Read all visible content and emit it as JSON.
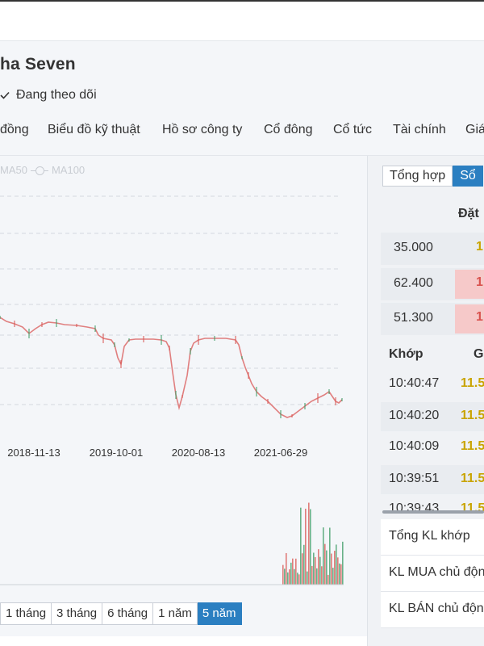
{
  "company_name": "ha Seven",
  "follow_status": "Đang theo dõi",
  "tabs": [
    "đồng",
    "Biểu đồ kỹ thuật",
    "Hồ sơ công ty",
    "Cổ đông",
    "Cổ tức",
    "Tài chính",
    "Giá"
  ],
  "chart": {
    "legend": [
      "MA50",
      "MA100"
    ],
    "dates": [
      "2018-11-13",
      "2019-10-01",
      "2020-08-13",
      "2021-06-29"
    ],
    "ranges": [
      "1 tháng",
      "3 tháng",
      "6 tháng",
      "1 năm",
      "5 năm"
    ],
    "active_range": "5 năm",
    "colors": {
      "price_line": "#e07f7f",
      "candle_up": "#3a9a62",
      "candle_down": "#d9534f",
      "grid": "#d3d8de"
    }
  },
  "chart_data": {
    "type": "line",
    "x": [
      "2018-11-13",
      "2019-10-01",
      "2020-08-13",
      "2021-06-29"
    ],
    "xlabel": "",
    "ylabel": "",
    "grid": true
  },
  "right_panel": {
    "tabs": [
      "Tổng hợp",
      "Sổ"
    ],
    "active_tab": "Sổ",
    "order_header": "Đặt",
    "orders": [
      {
        "price": "35.000",
        "value": "1",
        "value_color": "#c9a400",
        "highlight": ""
      },
      {
        "price": "62.400",
        "value": "1",
        "value_color": "#d9534f",
        "highlight": "#f6c9c9"
      },
      {
        "price": "51.300",
        "value": "1",
        "value_color": "#d9534f",
        "highlight": "#f6c9c9"
      }
    ],
    "trades_header": "Khớp",
    "trades_header_2": "G",
    "trades": [
      {
        "time": "10:40:47",
        "price": "11.5"
      },
      {
        "time": "10:40:20",
        "price": "11.5"
      },
      {
        "time": "10:40:09",
        "price": "11.5"
      },
      {
        "time": "10:39:51",
        "price": "11.5"
      },
      {
        "time": "10:39:43",
        "price": "11.5"
      }
    ],
    "trade_price_color": "#c9a400",
    "summary": [
      "Tổng KL khớp",
      "KL MUA chủ độn",
      "KL BÁN chủ độn"
    ]
  }
}
